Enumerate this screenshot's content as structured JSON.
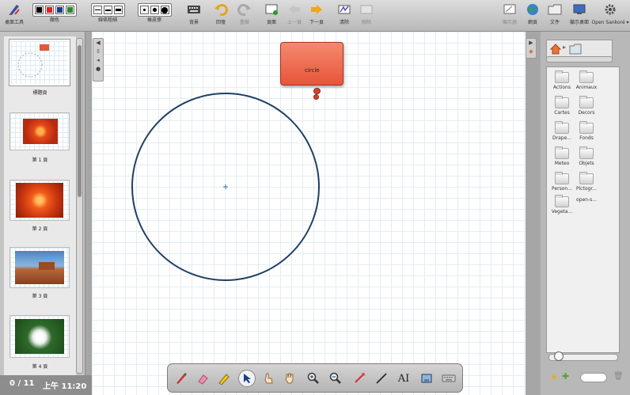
{
  "toolbar": {
    "desktop_tools_label": "桌面工具",
    "colors_label": "顏色",
    "line_width_label": "線條粗細",
    "eraser_size_label": "橡皮擦",
    "background_label": "背景",
    "undo_label": "回復",
    "redo_label": "重做",
    "page_label": "頁面",
    "prev_label": "上一頁",
    "next_label": "下一頁",
    "clear_label": "清除",
    "erase_label": "刪除",
    "display_label": "顯示器",
    "web_label": "網頁",
    "documents_label": "文件",
    "show_desktop_label": "顯示桌面",
    "open_sankore_label": "Open Sankoré",
    "colors": [
      "#000000",
      "#e02020",
      "#1a3c8c",
      "#2a8a2a"
    ]
  },
  "thumbnails": {
    "title_label": "標題頁",
    "pages": [
      "第 1 頁",
      "第 2 頁",
      "第 3 頁",
      "第 4 頁"
    ]
  },
  "status": {
    "page_count": "0 / 11",
    "time": "上午 11:20"
  },
  "board": {
    "callout_text": "circle"
  },
  "library": {
    "folders": [
      "Actions",
      "Animaux",
      "Cartes",
      "Decors",
      "Drape...",
      "Fonds",
      "Meteo",
      "Objets",
      "Person...",
      "Pictogr...",
      "open-s...",
      "Vegeta..."
    ]
  },
  "palette": {
    "tools": [
      "pen-tool",
      "eraser-tool",
      "highlighter-tool",
      "select-tool",
      "interact-tool",
      "hand-tool",
      "zoom-in-tool",
      "zoom-out-tool",
      "laser-tool",
      "line-tool",
      "text-tool",
      "capture-tool",
      "keyboard-tool"
    ],
    "text_tool_glyph": "AI"
  },
  "accent": {
    "callout": "#ec6b4f",
    "circle_stroke": "#1f3f64"
  }
}
